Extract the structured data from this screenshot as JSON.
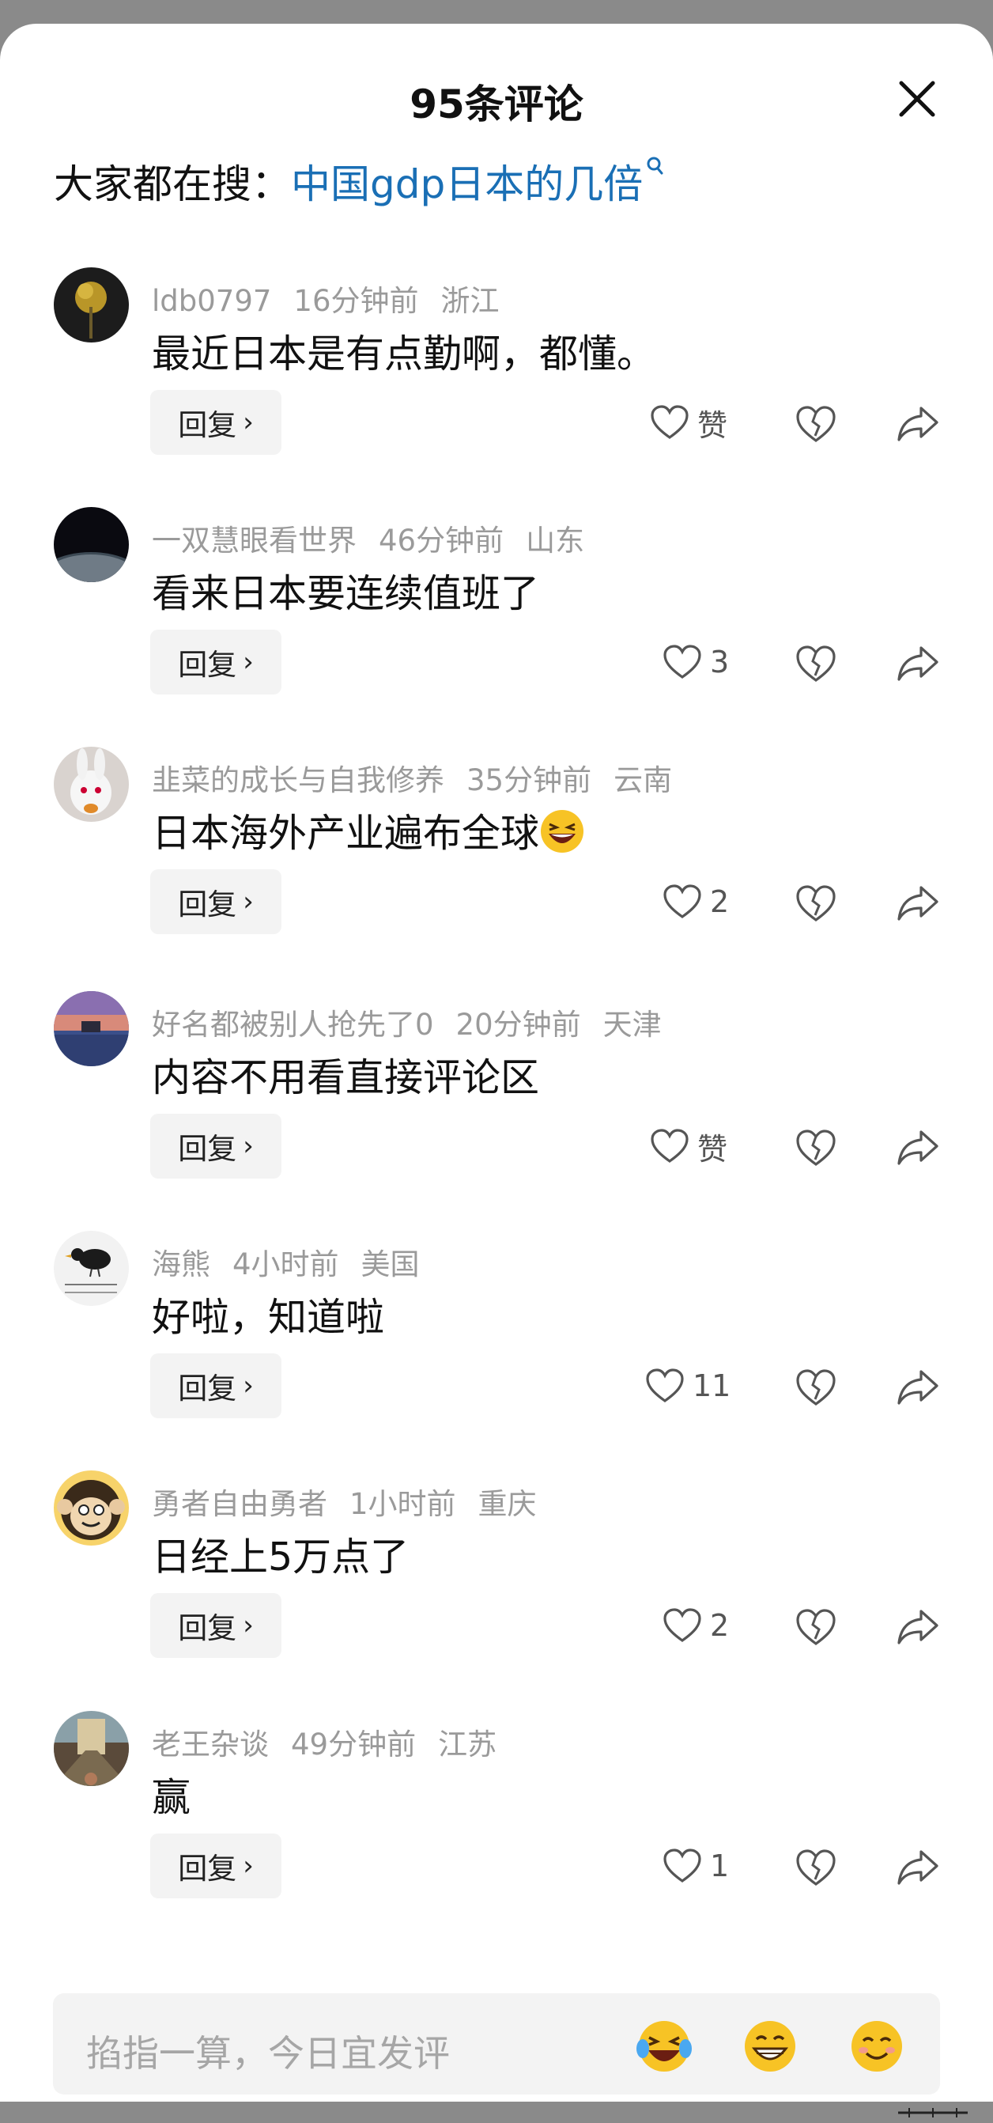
{
  "header": {
    "title": "95条评论",
    "trend_prefix": "大家都在搜：",
    "trend_link": "中国gdp日本的几倍"
  },
  "comments": [
    {
      "user": "ldb0797",
      "time": "16分钟前",
      "location": "浙江",
      "text": "最近日本是有点勤啊，都懂。",
      "likes": "赞",
      "reply_label": "回复"
    },
    {
      "user": "一双慧眼看世界",
      "time": "46分钟前",
      "location": "山东",
      "text": "看来日本要连续值班了",
      "likes": "3",
      "reply_label": "回复"
    },
    {
      "user": "韭菜的成长与自我修养",
      "time": "35分钟前",
      "location": "云南",
      "text": "日本海外产业遍布全球",
      "likes": "2",
      "reply_label": "回复"
    },
    {
      "user": "好名都被别人抢先了0",
      "time": "20分钟前",
      "location": "天津",
      "text": "内容不用看直接评论区",
      "likes": "赞",
      "reply_label": "回复"
    },
    {
      "user": "海熊",
      "time": "4小时前",
      "location": "美国",
      "text": "好啦，知道啦",
      "likes": "11",
      "reply_label": "回复"
    },
    {
      "user": "勇者自由勇者",
      "time": "1小时前",
      "location": "重庆",
      "text": "日经上5万点了",
      "likes": "2",
      "reply_label": "回复"
    },
    {
      "user": "老王杂谈",
      "time": "49分钟前",
      "location": "江苏",
      "text": "赢",
      "likes": "1",
      "reply_label": "回复"
    }
  ],
  "input": {
    "placeholder": "掐指一算，今日宜发评"
  },
  "emojis": [
    "laugh-cry-emoji-icon",
    "grin-emoji-icon",
    "smile-emoji-icon"
  ],
  "colors": {
    "accent_link": "#1a6fb5",
    "meta_text": "#9a9a9a",
    "reply_bg": "#f3f3f3"
  }
}
